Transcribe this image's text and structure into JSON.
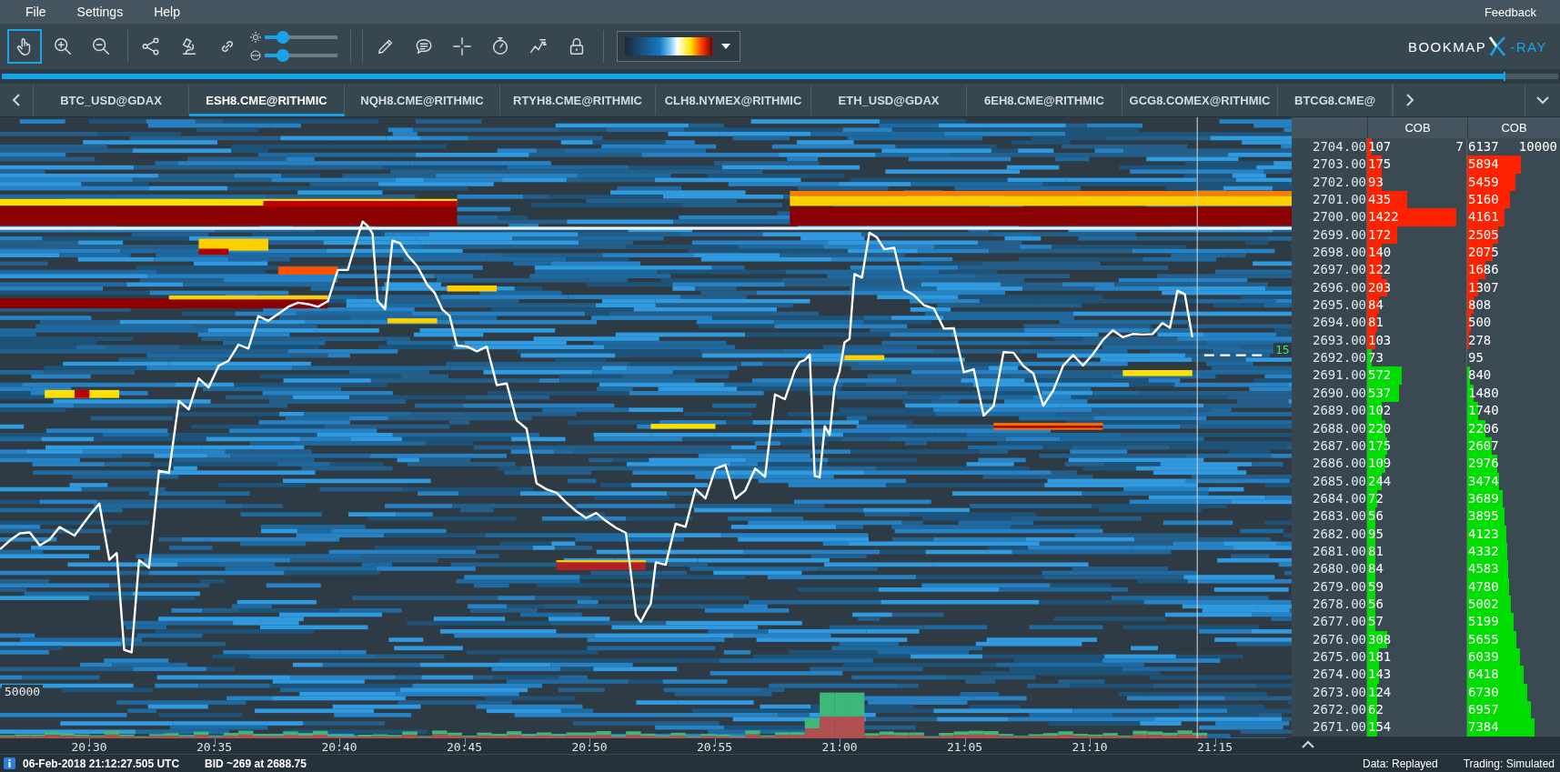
{
  "menu": [
    {
      "label": "File"
    },
    {
      "label": "Settings"
    },
    {
      "label": "Help"
    }
  ],
  "feedback": "Feedback",
  "toolbar": {
    "tools": [
      {
        "selected": true
      },
      {
        "selected": false
      },
      {
        "selected": false
      },
      {
        "selected": false
      },
      {
        "selected": false
      },
      {
        "selected": false
      },
      {
        "selected": false
      },
      {
        "selected": false
      },
      {
        "selected": false
      },
      {
        "selected": false
      },
      {
        "selected": false
      },
      {
        "selected": false
      }
    ],
    "sliders": [
      {
        "level": 0.25
      },
      {
        "level": 0.25
      }
    ]
  },
  "logo": {
    "word": "BOOKMAP",
    "suffix": "-RAY"
  },
  "replay_progress": {
    "level": 0.965
  },
  "tabs": [
    {
      "label": "BTC_USD@GDAX",
      "selected": false
    },
    {
      "label": "ESH8.CME@RITHMIC",
      "selected": true
    },
    {
      "label": "NQH8.CME@RITHMIC",
      "selected": false
    },
    {
      "label": "RTYH8.CME@RITHMIC",
      "selected": false
    },
    {
      "label": "CLH8.NYMEX@RITHMIC",
      "selected": false
    },
    {
      "label": "ETH_USD@GDAX",
      "selected": false
    },
    {
      "label": "6EH8.CME@RITHMIC",
      "selected": false
    },
    {
      "label": "GCG8.COMEX@RITHMIC",
      "selected": false
    },
    {
      "label": "BTCG8.CME@",
      "selected": false
    }
  ],
  "heatmap": {
    "volume_scale": "50000",
    "last_trade_marker": "15",
    "time_ticks": [
      "20:30",
      "20:35",
      "20:40",
      "20:45",
      "20:50",
      "20:55",
      "21:00",
      "21:05",
      "21:10",
      "21:15"
    ]
  },
  "ladder": {
    "columns": [
      "COB",
      "COB"
    ],
    "rows": [
      {
        "price": "2704.00",
        "color": "#ff2200",
        "cob": [
          {
            "value": "107",
            "note": "7",
            "level": 0.05
          },
          {
            "value": "6137",
            "note": "10000"
          }
        ]
      },
      {
        "price": "2703.00",
        "color": "#ff2200",
        "cob": [
          {
            "value": "175",
            "level": 0.15
          },
          {
            "value": "5894",
            "level": 0.58
          }
        ]
      },
      {
        "price": "2702.00",
        "color": "#ff2200",
        "cob": [
          {
            "value": "93",
            "level": 0.15
          },
          {
            "value": "5459",
            "level": 0.52
          }
        ]
      },
      {
        "price": "2701.00",
        "color": "#ff2200",
        "cob": [
          {
            "value": "435",
            "level": 0.4
          },
          {
            "value": "5160",
            "level": 0.46
          }
        ]
      },
      {
        "price": "2700.00",
        "color": "#ff2200",
        "cob": [
          {
            "value": "1422",
            "level": 0.9
          },
          {
            "value": "4161",
            "level": 0.4
          }
        ]
      },
      {
        "price": "2699.00",
        "color": "#ff2200",
        "cob": [
          {
            "value": "172",
            "level": 0.3
          },
          {
            "value": "2505",
            "level": 0.33
          }
        ]
      },
      {
        "price": "2698.00",
        "color": "#ff2200",
        "cob": [
          {
            "value": "140",
            "level": 0.15
          },
          {
            "value": "2075",
            "level": 0.27
          }
        ]
      },
      {
        "price": "2697.00",
        "color": "#ff2200",
        "cob": [
          {
            "value": "122",
            "level": 0.15
          },
          {
            "value": "1686",
            "level": 0.2
          }
        ]
      },
      {
        "price": "2696.00",
        "color": "#ff2200",
        "cob": [
          {
            "value": "203",
            "level": 0.2
          },
          {
            "value": "1307",
            "level": 0.12
          }
        ]
      },
      {
        "price": "2695.00",
        "color": "#ff2200",
        "cob": [
          {
            "value": "84",
            "level": 0.12
          },
          {
            "value": "808",
            "level": 0.07
          }
        ]
      },
      {
        "price": "2694.00",
        "color": "#ff2200",
        "cob": [
          {
            "value": "81",
            "level": 0.1
          },
          {
            "value": "500",
            "level": 0.04
          }
        ]
      },
      {
        "price": "2693.00",
        "color": "#ff2200",
        "cob": [
          {
            "value": "103",
            "level": 0.08
          },
          {
            "value": "278",
            "level": 0.02
          }
        ]
      },
      {
        "price": "2692.00",
        "color": "#00dd00",
        "cob": [
          {
            "value": "73",
            "level": 0.05
          },
          {
            "value": "95"
          }
        ]
      },
      {
        "price": "2691.00",
        "color": "#00dd00",
        "cob": [
          {
            "value": "572",
            "level": 0.35
          },
          {
            "value": "840",
            "level": 0.03
          }
        ]
      },
      {
        "price": "2690.00",
        "color": "#00dd00",
        "cob": [
          {
            "value": "537",
            "level": 0.32
          },
          {
            "value": "1480",
            "level": 0.07
          }
        ]
      },
      {
        "price": "2689.00",
        "color": "#00dd00",
        "cob": [
          {
            "value": "102",
            "level": 0.15
          },
          {
            "value": "1740",
            "level": 0.12
          }
        ]
      },
      {
        "price": "2688.00",
        "color": "#00dd00",
        "cob": [
          {
            "value": "220",
            "level": 0.18
          },
          {
            "value": "2206",
            "level": 0.2
          }
        ]
      },
      {
        "price": "2687.00",
        "color": "#00dd00",
        "cob": [
          {
            "value": "175",
            "level": 0.2
          },
          {
            "value": "2607",
            "level": 0.26
          }
        ]
      },
      {
        "price": "2686.00",
        "color": "#00dd00",
        "cob": [
          {
            "value": "109",
            "level": 0.18
          },
          {
            "value": "2976",
            "level": 0.32
          }
        ]
      },
      {
        "price": "2685.00",
        "color": "#00dd00",
        "cob": [
          {
            "value": "244",
            "level": 0.15
          },
          {
            "value": "3474",
            "level": 0.34
          }
        ]
      },
      {
        "price": "2684.00",
        "color": "#00dd00",
        "cob": [
          {
            "value": "72",
            "level": 0.1
          },
          {
            "value": "3689",
            "level": 0.38
          }
        ]
      },
      {
        "price": "2683.00",
        "color": "#00dd00",
        "cob": [
          {
            "value": "56",
            "level": 0.08
          },
          {
            "value": "3895",
            "level": 0.4
          }
        ]
      },
      {
        "price": "2682.00",
        "color": "#00dd00",
        "cob": [
          {
            "value": "95",
            "level": 0.08
          },
          {
            "value": "4123",
            "level": 0.42
          }
        ]
      },
      {
        "price": "2681.00",
        "color": "#00dd00",
        "cob": [
          {
            "value": "81",
            "level": 0.08
          },
          {
            "value": "4332",
            "level": 0.43
          }
        ]
      },
      {
        "price": "2680.00",
        "color": "#00dd00",
        "cob": [
          {
            "value": "84",
            "level": 0.08
          },
          {
            "value": "4583",
            "level": 0.44
          }
        ]
      },
      {
        "price": "2679.00",
        "color": "#00dd00",
        "cob": [
          {
            "value": "59",
            "level": 0.08
          },
          {
            "value": "4780",
            "level": 0.45
          }
        ]
      },
      {
        "price": "2678.00",
        "color": "#00dd00",
        "cob": [
          {
            "value": "56",
            "level": 0.08
          },
          {
            "value": "5002",
            "level": 0.47
          }
        ]
      },
      {
        "price": "2677.00",
        "color": "#00dd00",
        "cob": [
          {
            "value": "57",
            "level": 0.08
          },
          {
            "value": "5199",
            "level": 0.5
          }
        ]
      },
      {
        "price": "2676.00",
        "color": "#00dd00",
        "cob": [
          {
            "value": "308",
            "level": 0.2
          },
          {
            "value": "5655",
            "level": 0.53
          }
        ]
      },
      {
        "price": "2675.00",
        "color": "#00dd00",
        "cob": [
          {
            "value": "181",
            "level": 0.12
          },
          {
            "value": "6039",
            "level": 0.57
          }
        ]
      },
      {
        "price": "2674.00",
        "color": "#00dd00",
        "cob": [
          {
            "value": "143",
            "level": 0.12
          },
          {
            "value": "6418",
            "level": 0.61
          }
        ]
      },
      {
        "price": "2673.00",
        "color": "#00dd00",
        "cob": [
          {
            "value": "124",
            "level": 0.1
          },
          {
            "value": "6730",
            "level": 0.65
          }
        ]
      },
      {
        "price": "2672.00",
        "color": "#00dd00",
        "cob": [
          {
            "value": "62",
            "level": 0.1
          },
          {
            "value": "6957",
            "level": 0.69
          }
        ]
      },
      {
        "price": "2671.00",
        "color": "#00dd00",
        "cob": [
          {
            "value": "154",
            "level": 0.1
          },
          {
            "value": "7384",
            "level": 0.73
          }
        ]
      }
    ]
  },
  "status_bar": {
    "timestamp": "06-Feb-2018 21:12:27.505 UTC",
    "bid": "BID ~269 at 2688.75",
    "data": "Data: Replayed",
    "trading": "Trading: Simulated"
  }
}
